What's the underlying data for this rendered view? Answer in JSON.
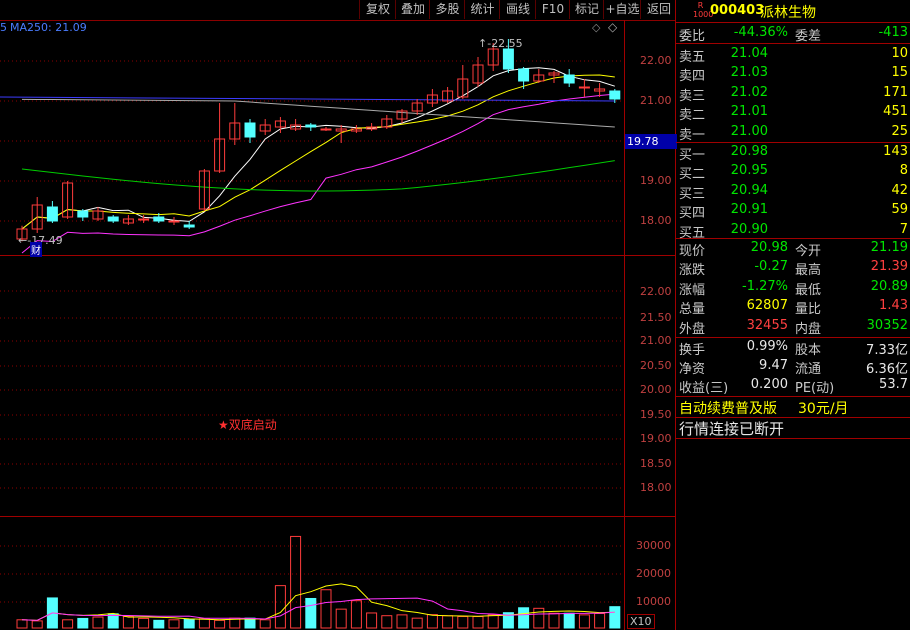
{
  "toolbar": {
    "buttons": [
      "复权",
      "叠加",
      "多股",
      "统计",
      "画线",
      "F10",
      "标记",
      "+自选",
      "返回"
    ]
  },
  "chart_data": {
    "type": "candlestick",
    "price_panel": {
      "ma_label": "MA250: 21.09",
      "y_ticks": [
        "22.00",
        "21.00",
        "19.78",
        "19.00",
        "18.00"
      ],
      "current_price_tag": "19.78",
      "high_label": "22.55",
      "low_label": "17.49",
      "note_marker": "财",
      "candles": [
        {
          "o": 17.55,
          "c": 17.8,
          "h": 17.88,
          "l": 17.49
        },
        {
          "o": 17.8,
          "c": 18.4,
          "h": 18.6,
          "l": 17.7
        },
        {
          "o": 18.35,
          "c": 18.0,
          "h": 18.5,
          "l": 17.95
        },
        {
          "o": 18.1,
          "c": 18.95,
          "h": 19.0,
          "l": 18.05
        },
        {
          "o": 18.25,
          "c": 18.1,
          "h": 18.3,
          "l": 18.0
        },
        {
          "o": 18.05,
          "c": 18.25,
          "h": 18.35,
          "l": 18.0
        },
        {
          "o": 18.1,
          "c": 18.0,
          "h": 18.15,
          "l": 17.95
        },
        {
          "o": 17.95,
          "c": 18.05,
          "h": 18.15,
          "l": 17.9
        },
        {
          "o": 18.05,
          "c": 18.05,
          "h": 18.15,
          "l": 17.95
        },
        {
          "o": 18.1,
          "c": 18.0,
          "h": 18.2,
          "l": 17.95
        },
        {
          "o": 18.0,
          "c": 18.0,
          "h": 18.1,
          "l": 17.9
        },
        {
          "o": 17.9,
          "c": 17.85,
          "h": 18.0,
          "l": 17.8
        },
        {
          "o": 18.3,
          "c": 19.25,
          "h": 19.3,
          "l": 18.25
        },
        {
          "o": 19.25,
          "c": 20.05,
          "h": 20.95,
          "l": 19.2
        },
        {
          "o": 20.05,
          "c": 20.45,
          "h": 20.95,
          "l": 19.9
        },
        {
          "o": 20.45,
          "c": 20.1,
          "h": 20.55,
          "l": 19.95
        },
        {
          "o": 20.25,
          "c": 20.4,
          "h": 20.55,
          "l": 20.15
        },
        {
          "o": 20.35,
          "c": 20.5,
          "h": 20.6,
          "l": 20.2
        },
        {
          "o": 20.3,
          "c": 20.4,
          "h": 20.55,
          "l": 20.25
        },
        {
          "o": 20.4,
          "c": 20.35,
          "h": 20.45,
          "l": 20.25
        },
        {
          "o": 20.3,
          "c": 20.3,
          "h": 20.35,
          "l": 20.25
        },
        {
          "o": 20.25,
          "c": 20.3,
          "h": 20.4,
          "l": 19.95
        },
        {
          "o": 20.25,
          "c": 20.3,
          "h": 20.4,
          "l": 20.2
        },
        {
          "o": 20.3,
          "c": 20.35,
          "h": 20.45,
          "l": 20.25
        },
        {
          "o": 20.35,
          "c": 20.55,
          "h": 20.65,
          "l": 20.3
        },
        {
          "o": 20.55,
          "c": 20.75,
          "h": 20.8,
          "l": 20.45
        },
        {
          "o": 20.75,
          "c": 20.95,
          "h": 21.05,
          "l": 20.65
        },
        {
          "o": 20.95,
          "c": 21.15,
          "h": 21.3,
          "l": 20.85
        },
        {
          "o": 21.0,
          "c": 21.25,
          "h": 21.35,
          "l": 20.95
        },
        {
          "o": 21.1,
          "c": 21.55,
          "h": 21.9,
          "l": 21.05
        },
        {
          "o": 21.45,
          "c": 21.9,
          "h": 22.1,
          "l": 21.35
        },
        {
          "o": 21.9,
          "c": 22.3,
          "h": 22.45,
          "l": 21.75
        },
        {
          "o": 22.3,
          "c": 21.8,
          "h": 22.55,
          "l": 21.7
        },
        {
          "o": 21.8,
          "c": 21.5,
          "h": 21.85,
          "l": 21.3
        },
        {
          "o": 21.5,
          "c": 21.65,
          "h": 21.8,
          "l": 21.45
        },
        {
          "o": 21.65,
          "c": 21.7,
          "h": 21.75,
          "l": 21.45
        },
        {
          "o": 21.65,
          "c": 21.45,
          "h": 21.8,
          "l": 21.35
        },
        {
          "o": 21.35,
          "c": 21.35,
          "h": 21.55,
          "l": 21.1
        },
        {
          "o": 21.25,
          "c": 21.3,
          "h": 21.45,
          "l": 21.1
        },
        {
          "o": 21.25,
          "c": 21.05,
          "h": 21.3,
          "l": 20.95
        }
      ]
    },
    "indicator_panel": {
      "annotation": "★双底启动",
      "y_ticks": [
        "22.00",
        "21.50",
        "21.00",
        "20.50",
        "20.00",
        "19.50",
        "19.00",
        "18.50",
        "18.00"
      ]
    },
    "volume_panel": {
      "y_ticks": [
        "30000",
        "20000",
        "10000"
      ],
      "multiplier": "X10",
      "volumes": [
        3000,
        2600,
        11000,
        3000,
        3500,
        4000,
        5200,
        4200,
        3500,
        2800,
        3000,
        3200,
        3400,
        2800,
        3600,
        3600,
        3000,
        15500,
        33500,
        10800,
        14000,
        6900,
        10000,
        5500,
        4500,
        4800,
        3600,
        4900,
        4500,
        4200,
        4200,
        4800,
        5600,
        7400,
        7200,
        5400,
        5400,
        4800,
        5300,
        7800
      ]
    }
  },
  "quote": {
    "code": "000403",
    "name": "派林生物",
    "badge": "R",
    "committee_ratio_label": "委比",
    "committee_ratio": "-44.36%",
    "committee_diff_label": "委差",
    "committee_diff": "-413",
    "asks": [
      {
        "label": "卖五",
        "price": "21.04",
        "vol": "10"
      },
      {
        "label": "卖四",
        "price": "21.03",
        "vol": "15"
      },
      {
        "label": "卖三",
        "price": "21.02",
        "vol": "171"
      },
      {
        "label": "卖二",
        "price": "21.01",
        "vol": "451"
      },
      {
        "label": "卖一",
        "price": "21.00",
        "vol": "25"
      }
    ],
    "bids": [
      {
        "label": "买一",
        "price": "20.98",
        "vol": "143"
      },
      {
        "label": "买二",
        "price": "20.95",
        "vol": "8"
      },
      {
        "label": "买三",
        "price": "20.94",
        "vol": "42"
      },
      {
        "label": "买四",
        "price": "20.91",
        "vol": "59"
      },
      {
        "label": "买五",
        "price": "20.90",
        "vol": "7"
      }
    ],
    "stats": [
      {
        "l1": "现价",
        "v1": "20.98",
        "c1": "g",
        "l2": "今开",
        "v2": "21.19",
        "c2": "g"
      },
      {
        "l1": "涨跌",
        "v1": "-0.27",
        "c1": "g",
        "l2": "最高",
        "v2": "21.39",
        "c2": "r"
      },
      {
        "l1": "涨幅",
        "v1": "-1.27%",
        "c1": "g",
        "l2": "最低",
        "v2": "20.89",
        "c2": "g"
      },
      {
        "l1": "总量",
        "v1": "62807",
        "c1": "y",
        "l2": "量比",
        "v2": "1.43",
        "c2": "r"
      },
      {
        "l1": "外盘",
        "v1": "32455",
        "c1": "r",
        "l2": "内盘",
        "v2": "30352",
        "c2": "g"
      }
    ],
    "fundamentals": [
      {
        "l1": "换手",
        "v1": "0.99%",
        "l2": "股本",
        "v2": "7.33亿"
      },
      {
        "l1": "净资",
        "v1": "9.47",
        "l2": "流通",
        "v2": "6.36亿"
      },
      {
        "l1": "收益(三)",
        "v1": "0.200",
        "l2": "PE(动)",
        "v2": "53.7"
      }
    ],
    "promo": "自动续费普及版",
    "promo_price": "30元/月",
    "status": "行情连接已断开"
  },
  "colors": {
    "up": "#ff3c3c",
    "down": "#54ffff",
    "grid": "#a00000"
  }
}
